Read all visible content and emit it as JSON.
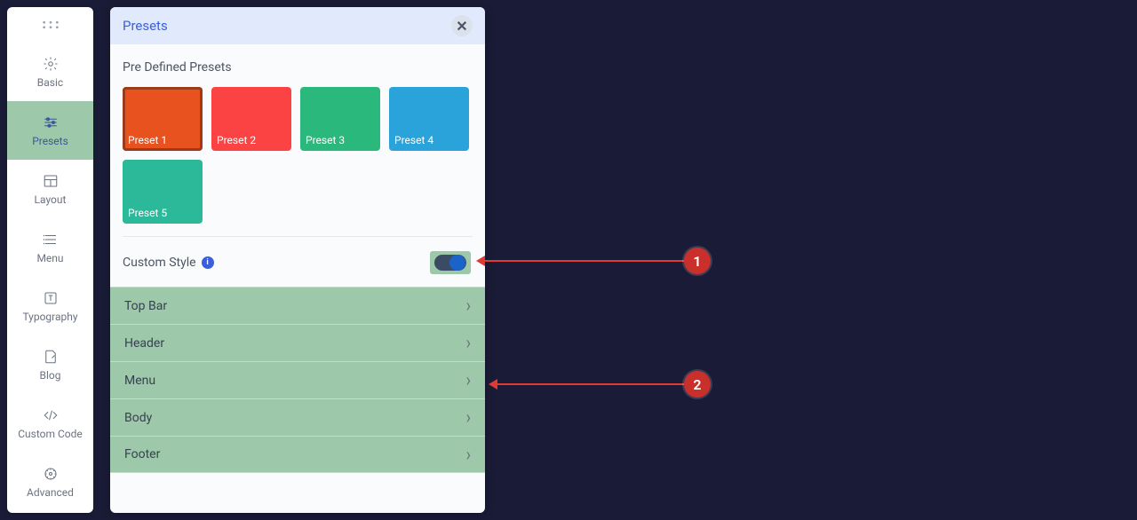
{
  "sidebar": {
    "items": [
      {
        "label": ""
      },
      {
        "label": "Basic"
      },
      {
        "label": "Presets"
      },
      {
        "label": "Layout"
      },
      {
        "label": "Menu"
      },
      {
        "label": "Typography"
      },
      {
        "label": "Blog"
      },
      {
        "label": "Custom Code"
      },
      {
        "label": "Advanced"
      }
    ]
  },
  "panel": {
    "title": "Presets",
    "predefined_label": "Pre Defined Presets",
    "presets": [
      {
        "label": "Preset 1",
        "color": "#e8521e",
        "selected": true
      },
      {
        "label": "Preset 2",
        "color": "#fb4343",
        "selected": false
      },
      {
        "label": "Preset 3",
        "color": "#2bb87d",
        "selected": false
      },
      {
        "label": "Preset 4",
        "color": "#29a3d9",
        "selected": false
      },
      {
        "label": "Preset 5",
        "color": "#2bb99a",
        "selected": false
      }
    ],
    "custom_style_label": "Custom Style",
    "custom_style_on": true,
    "accordion": [
      {
        "label": "Top Bar"
      },
      {
        "label": "Header"
      },
      {
        "label": "Menu"
      },
      {
        "label": "Body"
      },
      {
        "label": "Footer"
      }
    ]
  },
  "annotations": {
    "callout1": "1",
    "callout2": "2"
  }
}
